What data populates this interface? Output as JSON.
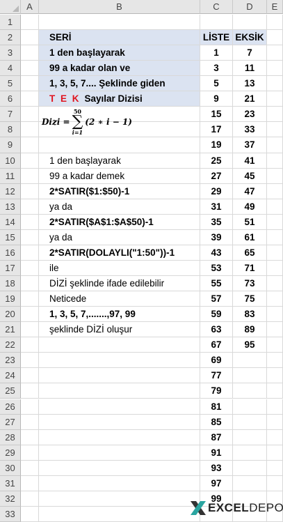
{
  "columns": [
    "A",
    "B",
    "C",
    "D",
    "E"
  ],
  "rows": [
    "1",
    "2",
    "3",
    "4",
    "5",
    "6",
    "7",
    "8",
    "9",
    "10",
    "11",
    "12",
    "13",
    "14",
    "15",
    "16",
    "17",
    "18",
    "19",
    "20",
    "21",
    "22",
    "23",
    "24",
    "25",
    "26",
    "27",
    "28",
    "29",
    "30",
    "31",
    "32",
    "33"
  ],
  "header": {
    "seri": "SERİ",
    "liste": "LİSTE",
    "eksik": "EKSİK"
  },
  "desc": {
    "r3": "1 den başlayarak",
    "r4": "99  a kadar olan ve",
    "r5": "1, 3, 5, 7.... Şeklinde giden",
    "r6_red": "T E K",
    "r6_rest": "Sayılar Dizisi",
    "formula_lhs": "Dizi =",
    "formula_sum": "∑",
    "formula_top": "50",
    "formula_bottom": "i=1",
    "formula_body": "(2 ∗ i − 1)",
    "r10": "1 den başlayarak",
    "r11": "99  a kadar  demek",
    "r12": "2*SATIR($1:$50)-1",
    "r13": "ya da",
    "r14": "2*SATIR($A$1:$A$50)-1",
    "r15": "ya da",
    "r16": "2*SATIR(DOLAYLI(\"1:50\"))-1",
    "r17": "ile",
    "r18": "DİZİ şeklinde ifade edilebilir",
    "r19": "Neticede",
    "r20": "1, 3, 5, 7,.......,97, 99",
    "r21": "şeklinde  DİZİ oluşur"
  },
  "liste": [
    "1",
    "3",
    "5",
    "9",
    "15",
    "17",
    "19",
    "25",
    "27",
    "29",
    "31",
    "35",
    "39",
    "43",
    "53",
    "55",
    "57",
    "59",
    "63",
    "67",
    "69",
    "77",
    "79",
    "81",
    "85",
    "87",
    "91",
    "93",
    "97",
    "99"
  ],
  "eksik": [
    "7",
    "11",
    "13",
    "21",
    "23",
    "33",
    "37",
    "41",
    "45",
    "47",
    "49",
    "51",
    "61",
    "65",
    "71",
    "73",
    "75",
    "83",
    "89",
    "95"
  ],
  "logo": {
    "bold": "EXCEL",
    "light": "DEPO"
  },
  "colors": {
    "header_fill": "#dbe3f1",
    "accent_red": "#e0141e",
    "logo_teal": "#2aa5a0"
  }
}
